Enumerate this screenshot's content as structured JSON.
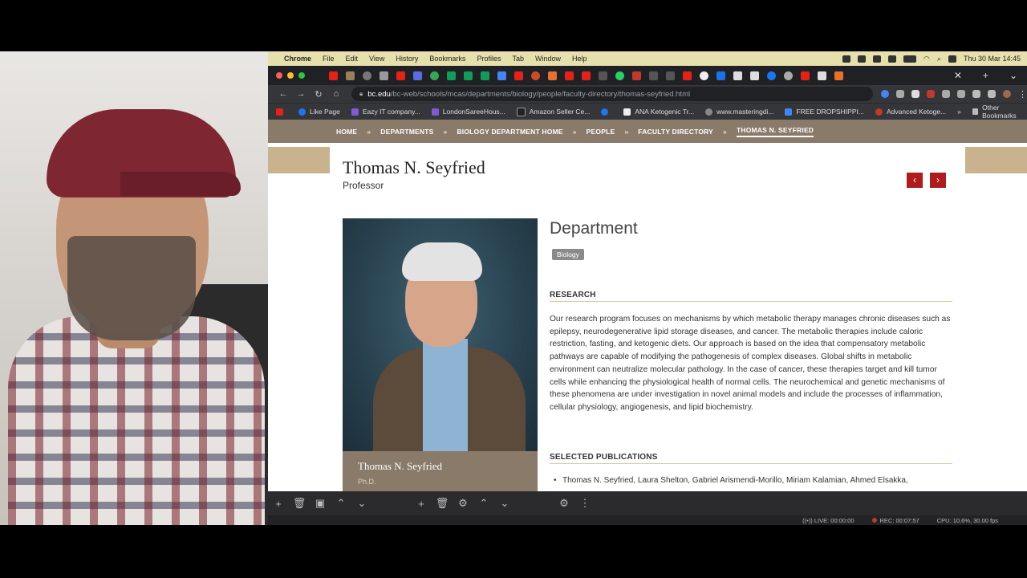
{
  "menubar": {
    "app": "Chrome",
    "items": [
      "File",
      "Edit",
      "View",
      "History",
      "Bookmarks",
      "Profiles",
      "Tab",
      "Window",
      "Help"
    ],
    "clock": "Thu 30 Mar  14:45"
  },
  "toolbar": {
    "url_host": "bc.edu",
    "url_path": "/bc-web/schools/mcas/departments/biology/people/faculty-directory/thomas-seyfried.html"
  },
  "bookmarks": {
    "items": [
      "Like Page",
      "Eazy IT company...",
      "LondonSareeHous...",
      "Amazon Seller Ce...",
      "ANA Ketogenic Tr...",
      "www.masteringdi...",
      "FREE DROPSHIPPI...",
      "Advanced Ketoge..."
    ],
    "other": "Other Bookmarks",
    "colors": [
      "#1877f2",
      "#7b5cd6",
      "#7b5cd6",
      "#ff9900",
      "#1877f2",
      "#888888",
      "#4285f4",
      "#c0392b"
    ]
  },
  "breadcrumb": [
    "HOME",
    "DEPARTMENTS",
    "BIOLOGY DEPARTMENT HOME",
    "PEOPLE",
    "FACULTY DIRECTORY",
    "THOMAS N. SEYFRIED"
  ],
  "profile": {
    "name": "Thomas N. Seyfried",
    "title": "Professor",
    "caption_name": "Thomas N. Seyfried",
    "caption_degree": "Ph.D."
  },
  "department": {
    "heading": "Department",
    "badge": "Biology"
  },
  "research": {
    "heading": "RESEARCH",
    "text": "Our research program focuses on mechanisms by which metabolic therapy manages chronic diseases such as epilepsy, neurodegenerative lipid storage diseases, and cancer. The metabolic therapies include caloric restriction, fasting, and ketogenic diets.  Our approach is based on the idea that compensatory metabolic pathways are capable of modifying the pathogenesis of complex diseases. Global shifts in metabolic environment can neutralize molecular pathology. In the case of cancer, these therapies target and kill tumor cells while enhancing the physiological health of normal cells. The neurochemical and genetic mechanisms of these phenomena are under investigation in novel animal models and include the processes of inflammation, cellular physiology, angiogenesis, and lipid biochemistry."
  },
  "publications": {
    "heading": "SELECTED PUBLICATIONS",
    "first": "Thomas N. Seyfried, Laura Shelton, Gabriel Arismendi-Morillo, Miriam Kalamian, Ahmed Elsakka,"
  },
  "obs": {
    "live": "LIVE: 00:00:00",
    "rec": "REC: 00:07:57",
    "cpu": "CPU: 10.6%, 30.00 fps"
  }
}
